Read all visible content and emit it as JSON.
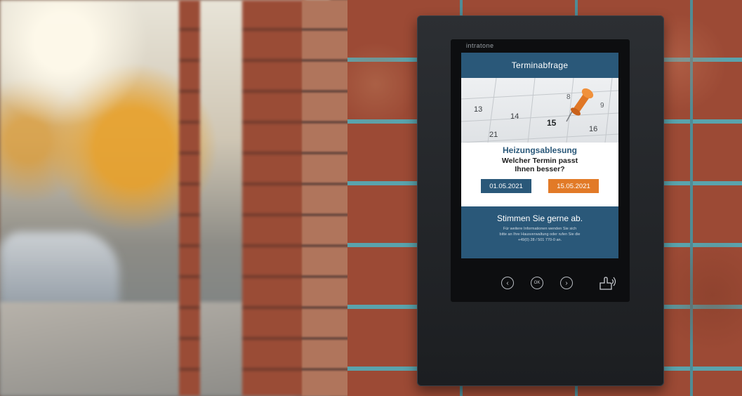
{
  "device": {
    "brand": "intratone",
    "screen": {
      "header": "Terminabfrage",
      "title": "Heizungsablesung",
      "question_line1": "Welcher Termin passt",
      "question_line2": "Ihnen besser?",
      "date_options": [
        "01.05.2021",
        "15.05.2021"
      ],
      "footer_title": "Stimmen Sie gerne ab.",
      "footer_text_line1": "Für weitere Informationen wenden Sie sich",
      "footer_text_line2": "bitte an Ihre Hausverwaltung oder rufen Sie die",
      "footer_text_line3": "+49(0) 28 / 501 770-0 an.",
      "calendar_numbers": [
        "13",
        "14",
        "15",
        "16",
        "21",
        "8",
        "9"
      ]
    },
    "controls": {
      "prev_icon": "chevron-left-icon",
      "ok_label": "OK",
      "next_icon": "chevron-right-icon",
      "touch_icon": "hand-touch-icon"
    }
  },
  "colors": {
    "brand_blue": "#2a5879",
    "accent_orange": "#e27a27"
  }
}
